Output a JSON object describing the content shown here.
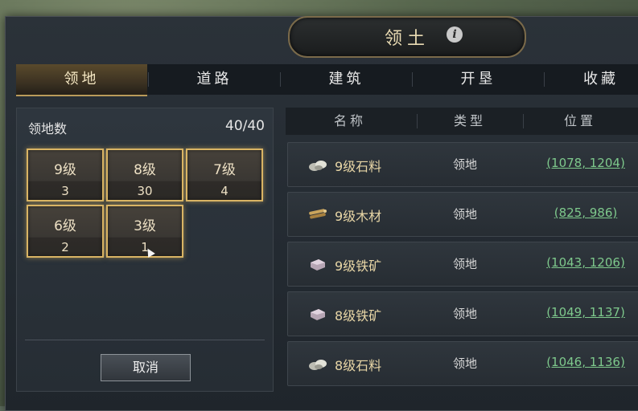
{
  "title": "领土",
  "tabs": [
    {
      "label": "领地",
      "active": true
    },
    {
      "label": "道路",
      "active": false
    },
    {
      "label": "建筑",
      "active": false
    },
    {
      "label": "开垦",
      "active": false
    },
    {
      "label": "收藏",
      "active": false
    }
  ],
  "left": {
    "count_label": "领地数",
    "count_value": "40/40",
    "levels": [
      {
        "name": "9级",
        "count": "3"
      },
      {
        "name": "8级",
        "count": "30"
      },
      {
        "name": "7级",
        "count": "4"
      },
      {
        "name": "6级",
        "count": "2"
      },
      {
        "name": "3级",
        "count": "1"
      }
    ],
    "cancel_label": "取消"
  },
  "table": {
    "headers": [
      "名称",
      "类型",
      "位置"
    ],
    "rows": [
      {
        "icon": "stone-icon",
        "name": "9级石料",
        "type": "领地",
        "pos": "(1078, 1204)"
      },
      {
        "icon": "wood-icon",
        "name": "9级木材",
        "type": "领地",
        "pos": "(825, 986)"
      },
      {
        "icon": "iron-icon",
        "name": "9级铁矿",
        "type": "领地",
        "pos": "(1043, 1206)"
      },
      {
        "icon": "iron-icon",
        "name": "8级铁矿",
        "type": "领地",
        "pos": "(1049, 1137)"
      },
      {
        "icon": "stone-icon",
        "name": "8级石料",
        "type": "领地",
        "pos": "(1046, 1136)"
      }
    ]
  },
  "colors": {
    "accent_gold": "#d9b464",
    "link_green": "#7ec98c"
  }
}
